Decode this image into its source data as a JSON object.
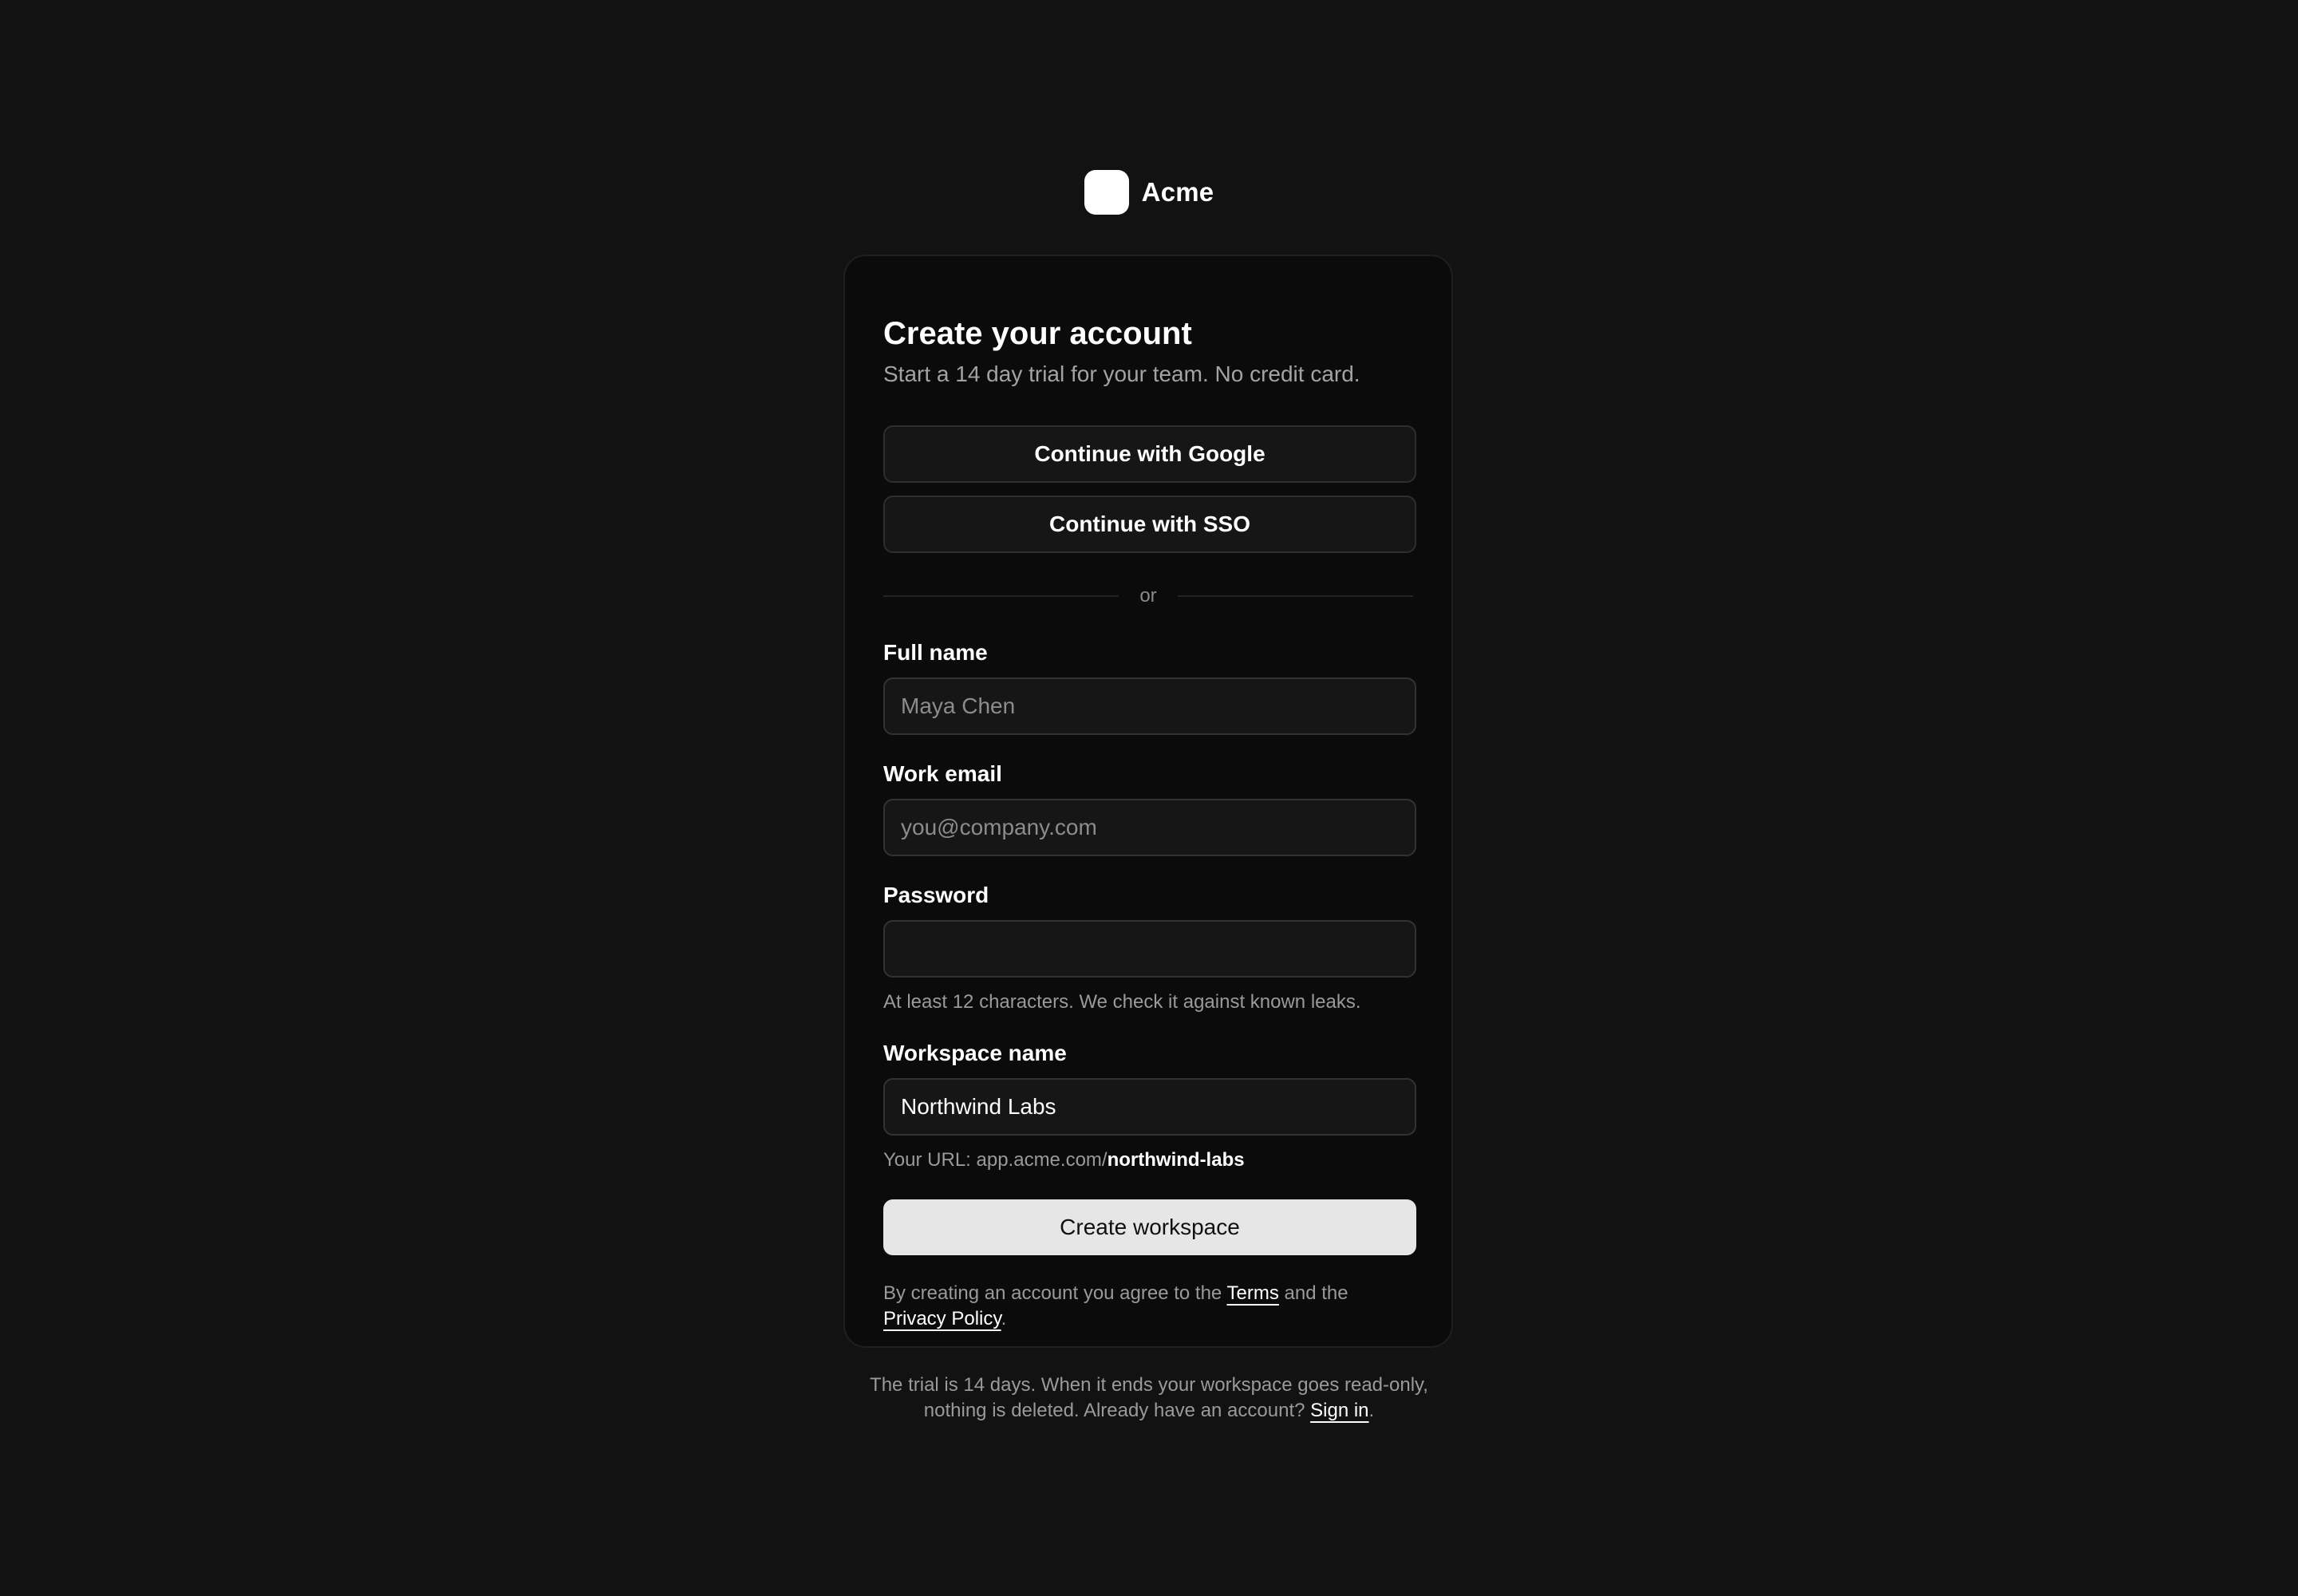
{
  "brand": {
    "name": "Acme",
    "logo_icon": "square-logo-icon"
  },
  "card": {
    "title": "Create your account",
    "subtitle": "Start a 14 day trial for your team. No credit card."
  },
  "oauth": {
    "google_label": "Continue with Google",
    "sso_label": "Continue with SSO"
  },
  "divider": {
    "text": "or"
  },
  "form": {
    "full_name": {
      "label": "Full name",
      "placeholder": "Maya Chen",
      "value": ""
    },
    "work_email": {
      "label": "Work email",
      "placeholder": "you@company.com",
      "value": ""
    },
    "password": {
      "label": "Password",
      "value": "",
      "helper": "At least 12 characters. We check it against known leaks."
    },
    "workspace": {
      "label": "Workspace name",
      "value": "Northwind Labs",
      "url_prefix": "Your URL: app.acme.com/",
      "url_slug": "northwind-labs"
    },
    "submit_label": "Create workspace"
  },
  "legal": {
    "prefix": "By creating an account you agree to the ",
    "terms_link": "Terms",
    "middle": " and the",
    "privacy_link": "Privacy Policy",
    "suffix": "."
  },
  "footer": {
    "line1": "The trial is 14 days. When it ends your workspace goes read-only,",
    "line2_prefix": "nothing is deleted. Already have an account? ",
    "signin_link": "Sign in",
    "line2_suffix": "."
  },
  "colors": {
    "background": "#121212",
    "card_background": "#0b0b0b",
    "primary_button": "#e6e6e6",
    "text_primary": "#ffffff",
    "text_muted": "#a3a3a3"
  }
}
